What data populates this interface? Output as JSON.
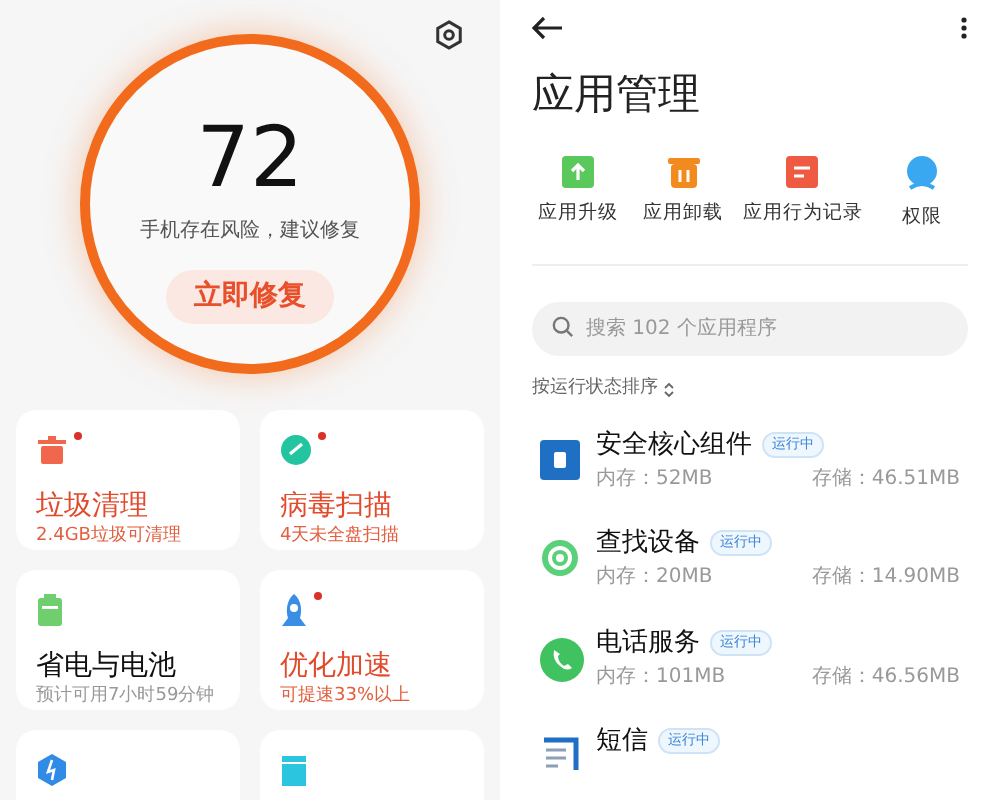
{
  "security": {
    "score": "72",
    "status": "手机存在风险，建议修复",
    "fix_button": "立即修复",
    "cards": [
      {
        "kind": "trash",
        "title": "垃圾清理",
        "subtitle": "2.4GB垃圾可清理",
        "alert": true
      },
      {
        "kind": "scan",
        "title": "病毒扫描",
        "subtitle": "4天未全盘扫描",
        "alert": true
      },
      {
        "kind": "battery",
        "title": "省电与电池",
        "subtitle": "预计可用7小时59分钟",
        "alert": false
      },
      {
        "kind": "rocket",
        "title": "优化加速",
        "subtitle": "可提速33%以上",
        "alert": true
      },
      {
        "kind": "shield"
      },
      {
        "kind": "box"
      }
    ]
  },
  "app_manager": {
    "title": "应用管理",
    "shortcuts": [
      {
        "kind": "upgrade",
        "label": "应用升级"
      },
      {
        "kind": "uninstall",
        "label": "应用卸载"
      },
      {
        "kind": "log",
        "label": "应用行为记录"
      },
      {
        "kind": "permission",
        "label": "权限"
      }
    ],
    "search": {
      "placeholder": "搜索 102 个应用程序"
    },
    "sort_label": "按运行状态排序",
    "apps": [
      {
        "kind": "core",
        "name": "安全核心组件",
        "badge": "运行中",
        "memory": "内存：52MB",
        "storage": "存储：46.51MB"
      },
      {
        "kind": "find",
        "name": "查找设备",
        "badge": "运行中",
        "memory": "内存：20MB",
        "storage": "存储：14.90MB"
      },
      {
        "kind": "phone",
        "name": "电话服务",
        "badge": "运行中",
        "memory": "内存：101MB",
        "storage": "存储：46.56MB"
      },
      {
        "kind": "sms",
        "name": "短信",
        "badge": "运行中"
      }
    ]
  }
}
